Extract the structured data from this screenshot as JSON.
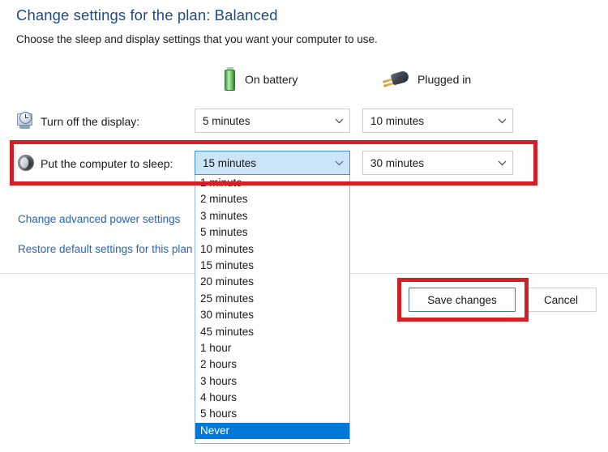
{
  "header": {
    "title": "Change settings for the plan: Balanced",
    "subtitle": "Choose the sleep and display settings that you want your computer to use.",
    "title_color": "#1f4b82"
  },
  "columns": [
    {
      "id": "on-battery",
      "label": "On battery",
      "icon": "battery-icon"
    },
    {
      "id": "plugged-in",
      "label": "Plugged in",
      "icon": "power-plug-icon"
    }
  ],
  "settings": [
    {
      "id": "turn-off-display",
      "label": "Turn off the display:",
      "icon": "display-clock-icon",
      "on_battery": "5 minutes",
      "plugged_in": "10 minutes",
      "open": false
    },
    {
      "id": "put-computer-to-sleep",
      "label": "Put the computer to sleep:",
      "icon": "sleep-moon-icon",
      "on_battery": "15 minutes",
      "plugged_in": "30 minutes",
      "open": true
    }
  ],
  "dropdown": {
    "owner": "put-computer-to-sleep-on-battery",
    "selected": "Never",
    "highlight_color": "#0078d7",
    "options": [
      "1 minute",
      "2 minutes",
      "3 minutes",
      "5 minutes",
      "10 minutes",
      "15 minutes",
      "20 minutes",
      "25 minutes",
      "30 minutes",
      "45 minutes",
      "1 hour",
      "2 hours",
      "3 hours",
      "4 hours",
      "5 hours",
      "Never"
    ]
  },
  "links": [
    {
      "id": "change-advanced-power-settings",
      "label": "Change advanced power settings"
    },
    {
      "id": "restore-default-settings",
      "label": "Restore default settings for this plan"
    }
  ],
  "footer": {
    "save_label": "Save changes",
    "cancel_label": "Cancel"
  },
  "annotations": {
    "color": "#d31f26",
    "items": [
      {
        "id": "sleep-row-highlight",
        "target": "put-computer-to-sleep"
      },
      {
        "id": "save-button-highlight",
        "target": "save-changes-button"
      }
    ]
  }
}
